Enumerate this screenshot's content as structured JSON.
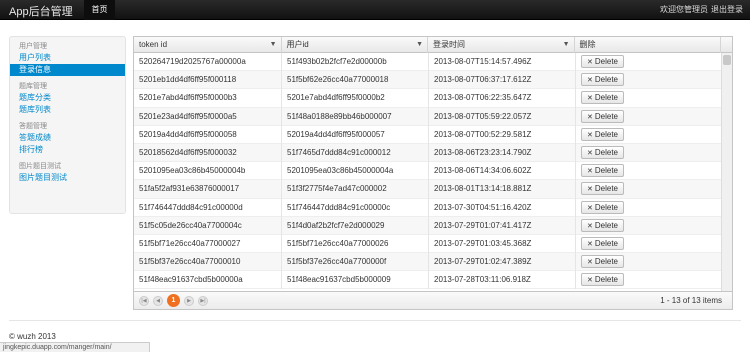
{
  "navbar": {
    "brand": "App后台管理",
    "home": "首页",
    "welcome": "欢迎您管理员",
    "logout": "退出登录"
  },
  "sidebar": {
    "sections": [
      {
        "header": "用户管理",
        "items": [
          {
            "label": "用户列表",
            "active": false
          },
          {
            "label": "登录信息",
            "active": true
          }
        ]
      },
      {
        "header": "题库管理",
        "items": [
          {
            "label": "题库分类",
            "active": false
          },
          {
            "label": "题库列表",
            "active": false
          }
        ]
      },
      {
        "header": "答题管理",
        "items": [
          {
            "label": "答题成绩",
            "active": false
          },
          {
            "label": "排行榜",
            "active": false
          }
        ]
      },
      {
        "header": "图片题目测试",
        "items": [
          {
            "label": "图片题目测试",
            "active": false
          }
        ]
      }
    ]
  },
  "grid": {
    "columns": [
      "token id",
      "用户id",
      "登录时间",
      "删除"
    ],
    "delete_label": "Delete",
    "rows": [
      [
        "520264719d2025767a00000a",
        "51f493b02b2fcf7e2d00000b",
        "2013-08-07T15:14:57.496Z"
      ],
      [
        "5201eb1dd4df6ff95f000118",
        "51f5bf62e26cc40a77000018",
        "2013-08-07T06:37:17.612Z"
      ],
      [
        "5201e7abd4df6ff95f0000b3",
        "5201e7abd4df6ff95f0000b2",
        "2013-08-07T06:22:35.647Z"
      ],
      [
        "5201e23ad4df6ff95f0000a5",
        "51f48a0188e89bb46b000007",
        "2013-08-07T05:59:22.057Z"
      ],
      [
        "52019a4dd4df6ff95f000058",
        "52019a4dd4df6ff95f000057",
        "2013-08-07T00:52:29.581Z"
      ],
      [
        "52018562d4df6ff95f000032",
        "51f7465d7ddd84c91c000012",
        "2013-08-06T23:23:14.790Z"
      ],
      [
        "5201095ea03c86b45000004b",
        "5201095ea03c86b45000004a",
        "2013-08-06T14:34:06.602Z"
      ],
      [
        "51fa5f2af931e63876000017",
        "51f3f2775f4e7ad47c000002",
        "2013-08-01T13:14:18.881Z"
      ],
      [
        "51f746447ddd84c91c00000d",
        "51f746447ddd84c91c00000c",
        "2013-07-30T04:51:16.420Z"
      ],
      [
        "51f5c05de26cc40a7700004c",
        "51f4d0af2b2fcf7e2d000029",
        "2013-07-29T01:07:41.417Z"
      ],
      [
        "51f5bf71e26cc40a77000027",
        "51f5bf71e26cc40a77000026",
        "2013-07-29T01:03:45.368Z"
      ],
      [
        "51f5bf37e26cc40a77000010",
        "51f5bf37e26cc40a7700000f",
        "2013-07-29T01:02:47.389Z"
      ],
      [
        "51f48eac91637cbd5b00000a",
        "51f48eac91637cbd5b000009",
        "2013-07-28T03:11:06.918Z"
      ]
    ],
    "pager": {
      "current_page": "1",
      "info": "1 - 13 of 13 items"
    }
  },
  "footer": "© wuzh 2013",
  "status_url": "jingkepic.duapp.com/manger/main/"
}
